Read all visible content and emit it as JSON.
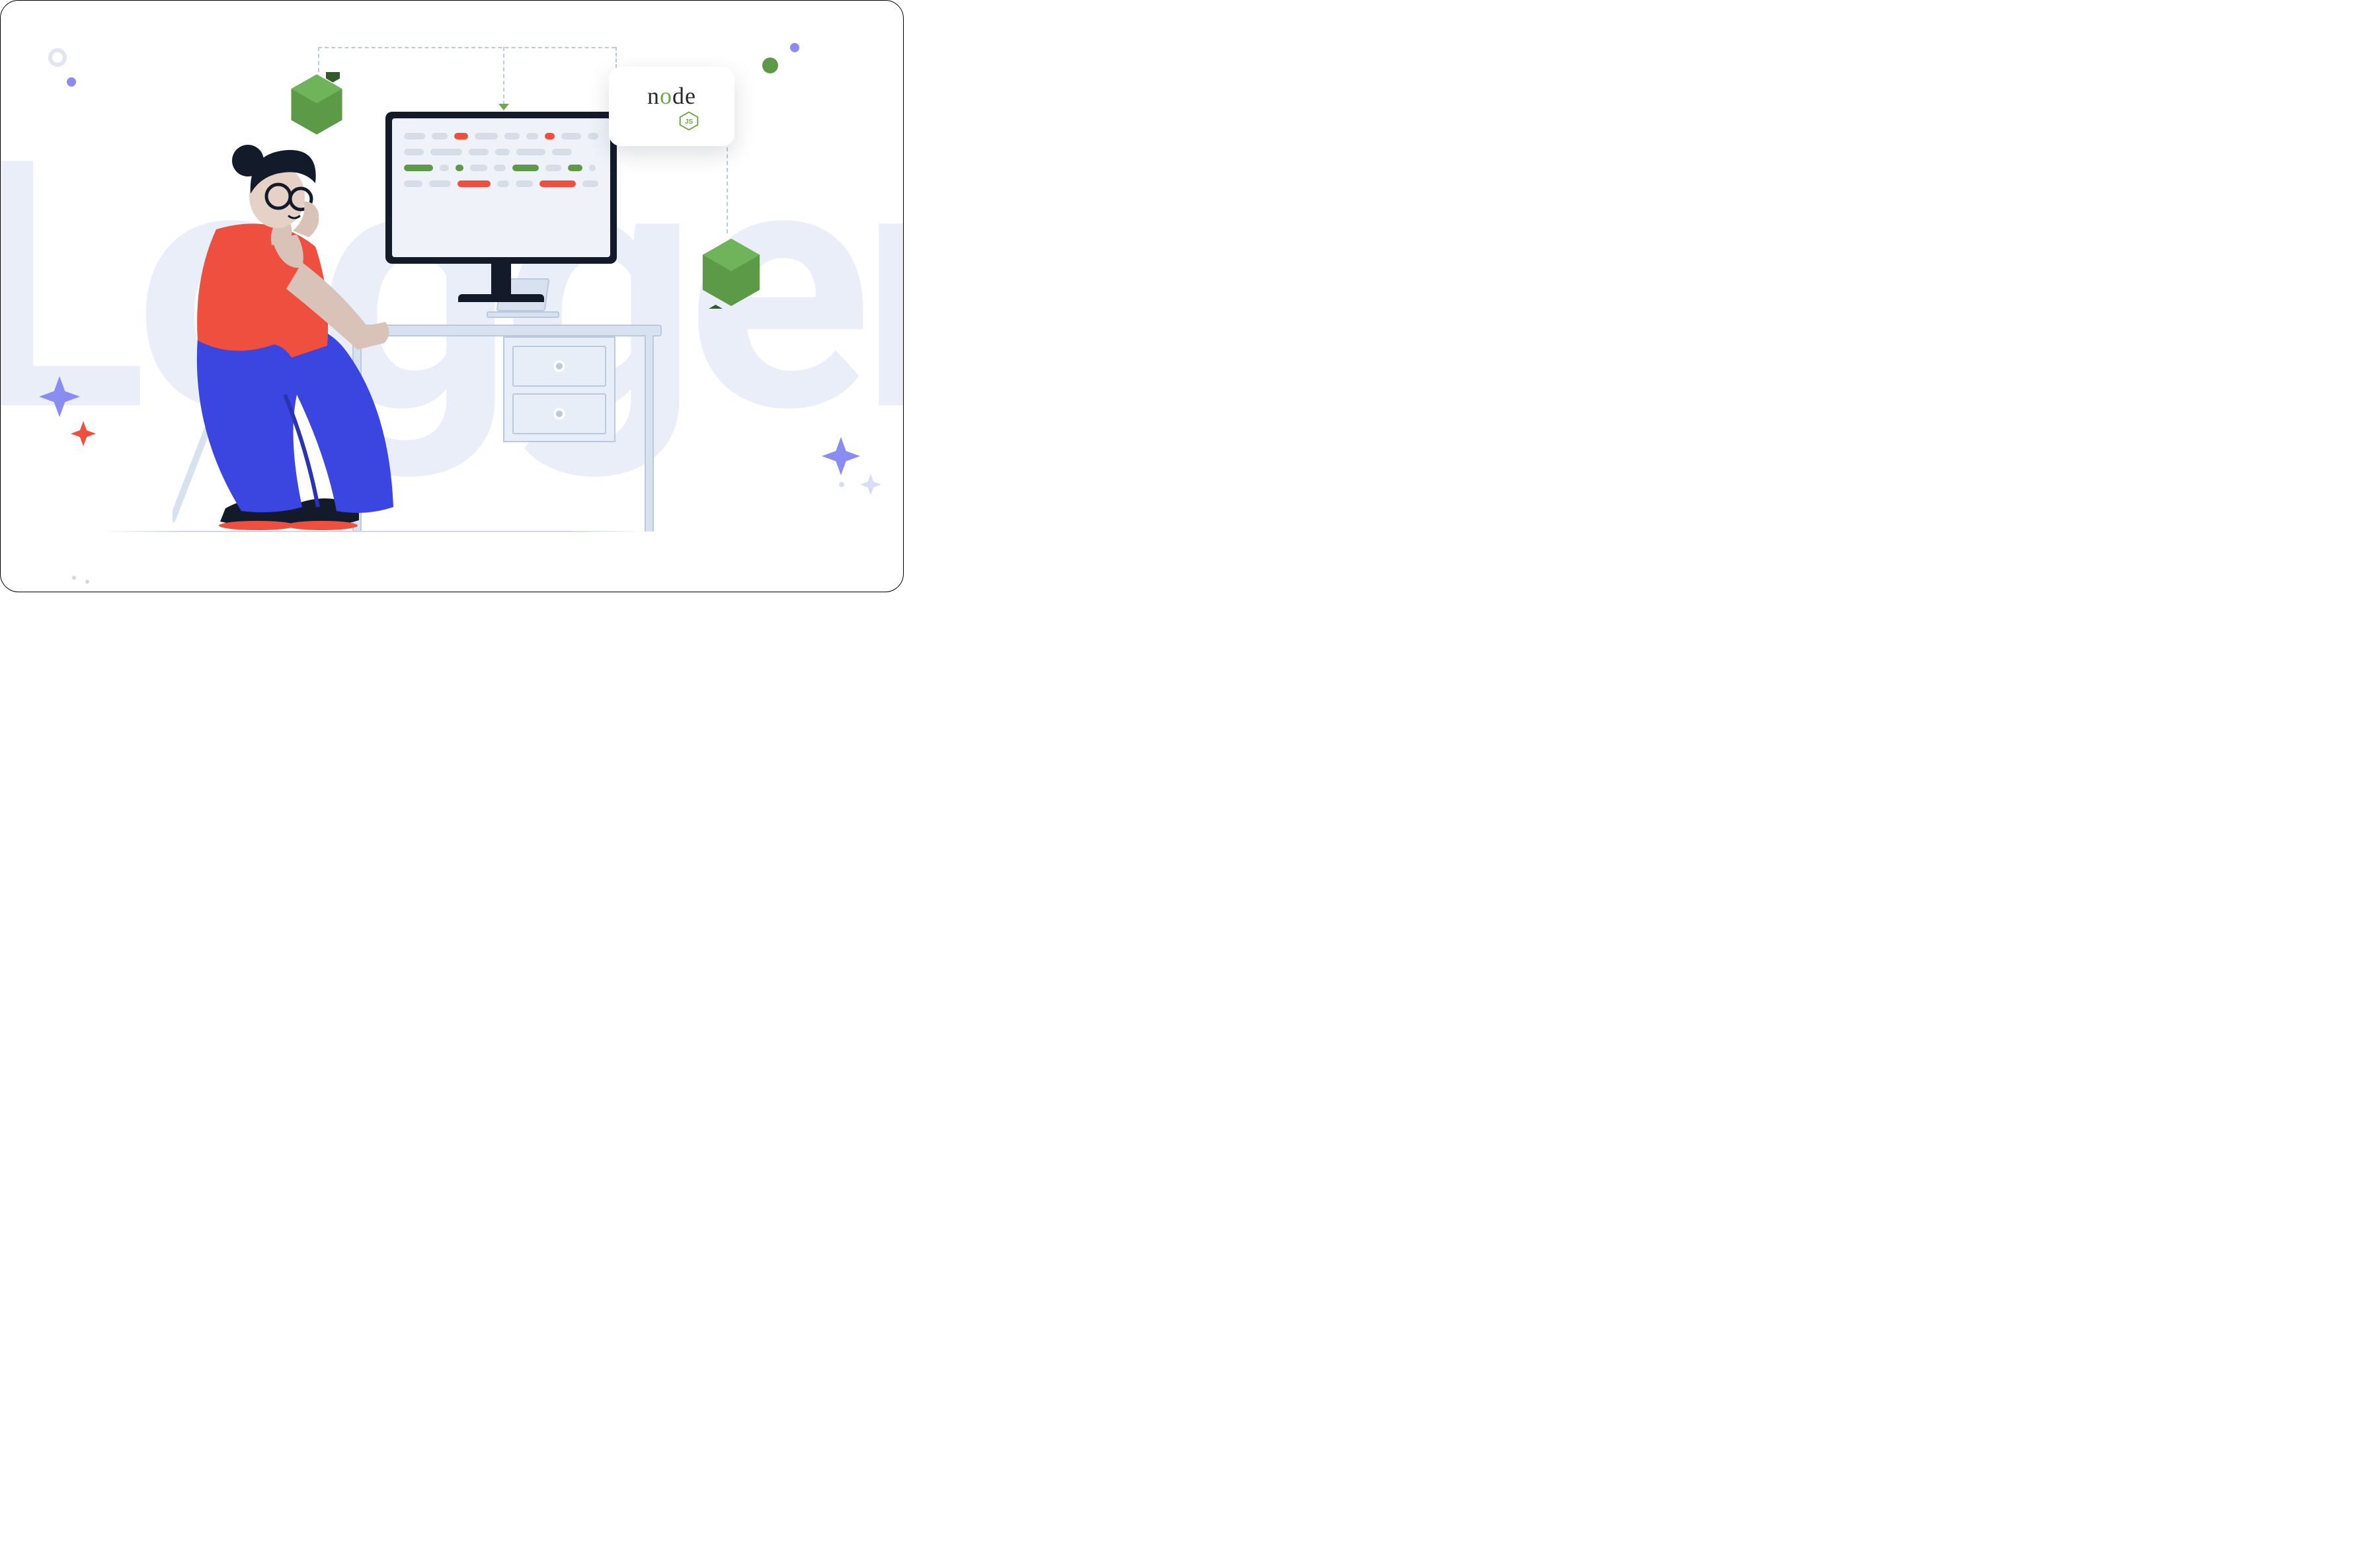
{
  "background_word": "Logger",
  "logo": {
    "word_before_o": "n",
    "word_o": "o",
    "word_after_o": "de",
    "sub": "JS"
  },
  "colors": {
    "red": "#ee4f3e",
    "green": "#5c9a48",
    "gray": "#d7dde7",
    "blue": "#3b45e0",
    "dark": "#131a2a",
    "lilac": "#8b8cf2",
    "palelilac": "#d9dbfb",
    "desk": "#d7e1ef",
    "bgword": "#e9eef8"
  },
  "code_rows": [
    [
      {
        "c": "gray",
        "w": 36
      },
      {
        "c": "gray",
        "w": 28
      },
      {
        "c": "red",
        "w": 24
      },
      {
        "c": "gray",
        "w": 40
      },
      {
        "c": "gray",
        "w": 26
      },
      {
        "c": "gray",
        "w": 20
      },
      {
        "c": "red",
        "w": 18
      },
      {
        "c": "gray",
        "w": 34
      },
      {
        "c": "gray",
        "w": 18
      }
    ],
    [
      {
        "c": "gray",
        "w": 30
      },
      {
        "c": "gray",
        "w": 48
      },
      {
        "c": "gray",
        "w": 30
      },
      {
        "c": "gray",
        "w": 22
      },
      {
        "c": "gray",
        "w": 44
      },
      {
        "c": "gray",
        "w": 30
      }
    ],
    [
      {
        "c": "green",
        "w": 44
      },
      {
        "c": "gray",
        "w": 14
      },
      {
        "c": "green",
        "w": 12
      },
      {
        "c": "gray",
        "w": 26
      },
      {
        "c": "gray",
        "w": 18
      },
      {
        "c": "green",
        "w": 40
      },
      {
        "c": "gray",
        "w": 24
      },
      {
        "c": "green",
        "w": 22
      },
      {
        "c": "gray",
        "w": 10
      }
    ],
    [
      {
        "c": "gray",
        "w": 28
      },
      {
        "c": "gray",
        "w": 34
      },
      {
        "c": "red",
        "w": 50
      },
      {
        "c": "gray",
        "w": 18
      },
      {
        "c": "gray",
        "w": 26
      },
      {
        "c": "red",
        "w": 56
      },
      {
        "c": "gray",
        "w": 24
      }
    ]
  ]
}
